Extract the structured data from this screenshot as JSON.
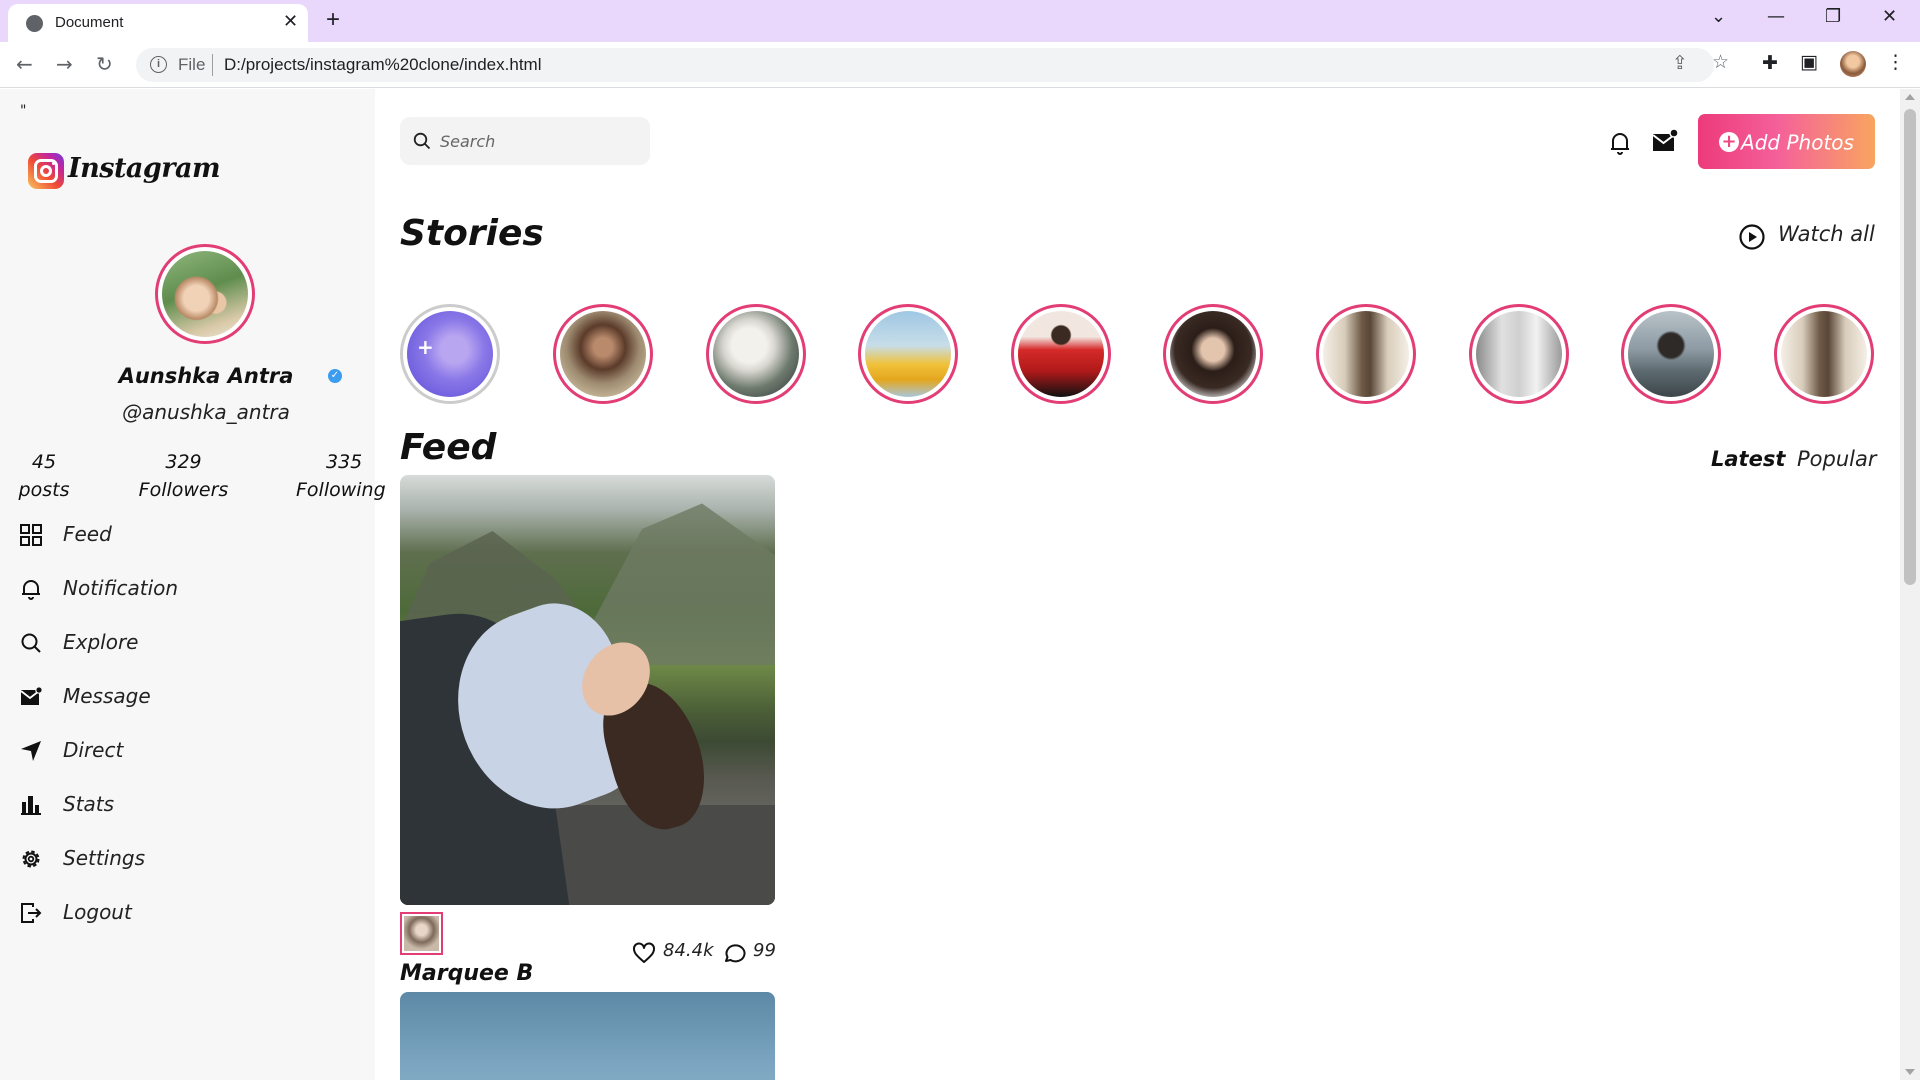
{
  "browser": {
    "tab_title": "Document",
    "url_scheme_label": "File",
    "url": "D:/projects/instagram%20clone/index.html"
  },
  "sidebar": {
    "quote_mark": "\"",
    "logo_text": "Instagram",
    "profile": {
      "name": "Aunshka Antra",
      "handle": "@anushka_antra",
      "stats": [
        {
          "value": "45",
          "label": "posts"
        },
        {
          "value": "329",
          "label": "Followers"
        },
        {
          "value": "335",
          "label": "Following"
        }
      ]
    },
    "nav": [
      {
        "label": "Feed",
        "icon": "grid-icon"
      },
      {
        "label": "Notification",
        "icon": "bell-icon"
      },
      {
        "label": "Explore",
        "icon": "search-icon"
      },
      {
        "label": "Message",
        "icon": "mail-icon"
      },
      {
        "label": "Direct",
        "icon": "send-icon"
      },
      {
        "label": "Stats",
        "icon": "bar-chart-icon"
      },
      {
        "label": "Settings",
        "icon": "gear-icon"
      },
      {
        "label": "Logout",
        "icon": "logout-icon"
      }
    ]
  },
  "header": {
    "search_placeholder": "Search",
    "add_photos_label": "Add Photos"
  },
  "stories": {
    "title": "Stories",
    "watch_all_label": "Watch all"
  },
  "feed": {
    "title": "Feed",
    "tabs": [
      "Latest",
      "Popular"
    ],
    "active_tab": "Latest",
    "posts": [
      {
        "author": "Marquee B",
        "likes": "84.4k",
        "comments": "99"
      }
    ]
  },
  "colors": {
    "accent_pink": "#e23d74",
    "button_gradient_start": "#ec3a7a",
    "button_gradient_end": "#f8a560",
    "verified_blue": "#3b9cf0"
  }
}
